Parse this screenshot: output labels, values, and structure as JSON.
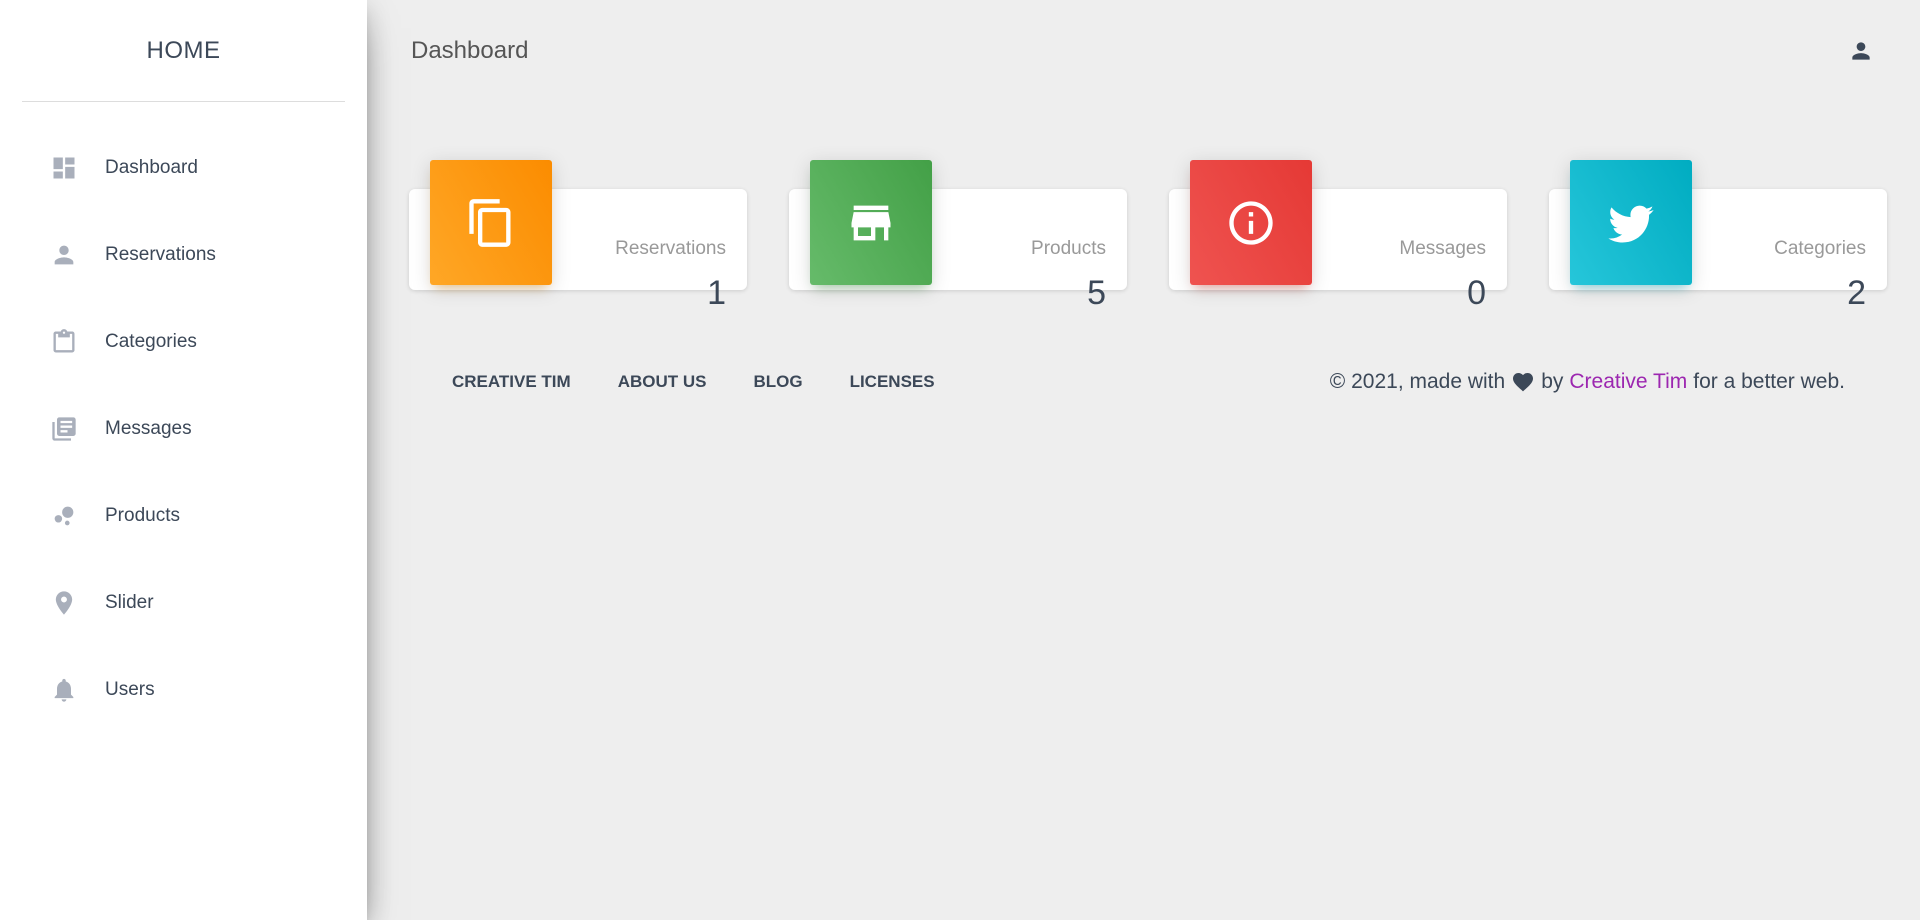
{
  "sidebar": {
    "logo": "HOME",
    "items": [
      {
        "label": "Dashboard",
        "icon": "dashboard-icon"
      },
      {
        "label": "Reservations",
        "icon": "person-icon"
      },
      {
        "label": "Categories",
        "icon": "clipboard-icon"
      },
      {
        "label": "Messages",
        "icon": "library-books-icon"
      },
      {
        "label": "Products",
        "icon": "bubble-chart-icon"
      },
      {
        "label": "Slider",
        "icon": "location-pin-icon"
      },
      {
        "label": "Users",
        "icon": "bell-icon"
      }
    ]
  },
  "header": {
    "title": "Dashboard",
    "user_icon": "person-icon"
  },
  "cards": [
    {
      "label": "Reservations",
      "value": "1",
      "icon": "copy-icon",
      "color": "#fb8c00"
    },
    {
      "label": "Products",
      "value": "5",
      "icon": "store-icon",
      "color": "#43a047"
    },
    {
      "label": "Messages",
      "value": "0",
      "icon": "info-icon",
      "color": "#e53935"
    },
    {
      "label": "Categories",
      "value": "2",
      "icon": "twitter-icon",
      "color": "#00acc1"
    }
  ],
  "footer": {
    "links": [
      "CREATIVE TIM",
      "ABOUT US",
      "BLOG",
      "LICENSES"
    ],
    "copyright_prefix": "© 2021, made with",
    "copyright_by": "by",
    "author": "Creative Tim",
    "copyright_suffix": "for a better web.",
    "heart_icon": "heart-icon",
    "author_color": "#9c27b0"
  }
}
